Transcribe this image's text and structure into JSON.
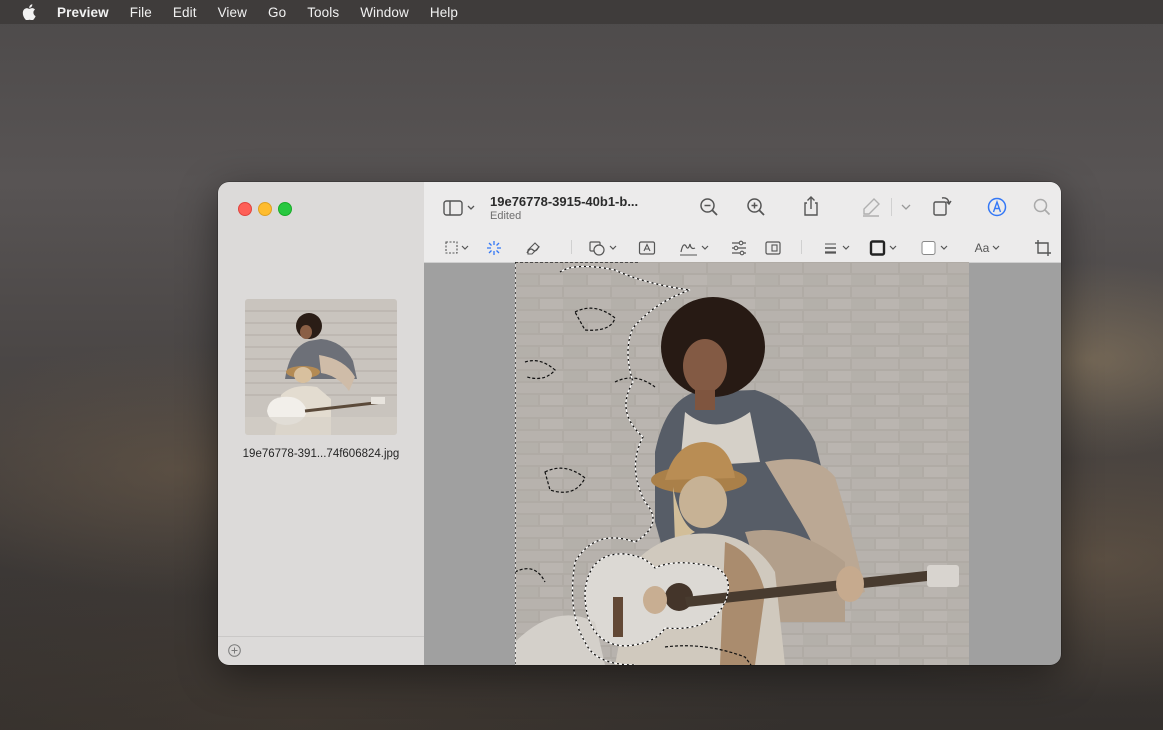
{
  "menubar": {
    "app_name": "Preview",
    "items": [
      "File",
      "Edit",
      "View",
      "Go",
      "Tools",
      "Window",
      "Help"
    ]
  },
  "window": {
    "title": "19e76778-3915-40b1-b...",
    "subtitle": "Edited",
    "sidebar": {
      "thumbnail_label": "19e76778-391...74f606824.jpg"
    },
    "toolbar": {
      "text_style_label": "Aa"
    }
  },
  "colors": {
    "accent": "#3478f6",
    "close": "#fe5f57",
    "minimize": "#febc2e",
    "maximize": "#28c840"
  },
  "icons": [
    "apple-icon",
    "sidebar-toggle-icon",
    "zoom-out-icon",
    "zoom-in-icon",
    "share-icon",
    "highlight-icon",
    "rotate-icon",
    "markup-icon",
    "search-icon",
    "rect-selection-icon",
    "instant-alpha-icon",
    "sketch-icon",
    "shapes-icon",
    "text-box-icon",
    "sign-icon",
    "adjust-color-icon",
    "adjust-size-icon",
    "shape-style-icon",
    "border-color-icon",
    "fill-color-icon",
    "text-style-icon",
    "crop-icon",
    "add-icon"
  ]
}
